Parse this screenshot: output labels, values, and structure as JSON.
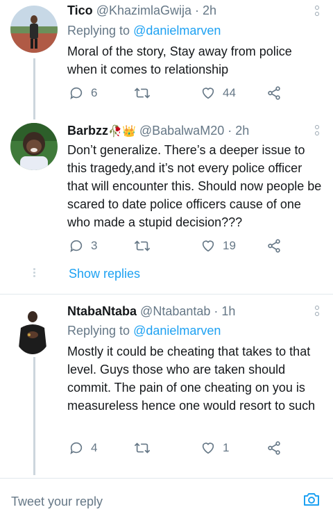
{
  "tweets": [
    {
      "name": "Tico",
      "handle": "@KhazimlaGwija",
      "time": "· 2h",
      "replying_label": "Replying to",
      "replying_handle": "@danielmarven",
      "text": "Moral of the story, Stay away from police when it comes to relationship",
      "replies": "6",
      "likes": "44"
    },
    {
      "name": "Barbzz",
      "name_emoji": "🥀👑",
      "handle": "@BabalwaM20",
      "time": "· 2h",
      "text": "Don’t generalize. There’s a deeper issue to this tragedy,and it’s not every police officer that will encounter this. Should now people be scared to date police officers cause of one who made a stupid decision???",
      "replies": "3",
      "likes": "19",
      "show_replies": "Show replies"
    },
    {
      "name": "NtabaNtaba",
      "handle": "@Ntabantab",
      "time": "· 1h",
      "replying_label": "Replying to",
      "replying_handle": "@danielmarven",
      "text": "Mostly it could be cheating that takes to that level. Guys those who are taken should commit. The pain of one cheating on you is measureless hence one would resort to such",
      "replies": "4",
      "likes": "1"
    }
  ],
  "composer": {
    "placeholder": "Tweet your reply"
  },
  "icons": [
    "reply-icon",
    "retweet-icon",
    "like-icon",
    "share-icon",
    "more-icon",
    "camera-icon"
  ],
  "colors": {
    "link": "#1da1f2",
    "muted": "#657786",
    "divider": "#e1e8ed",
    "thread_line": "#ccd6dd"
  }
}
